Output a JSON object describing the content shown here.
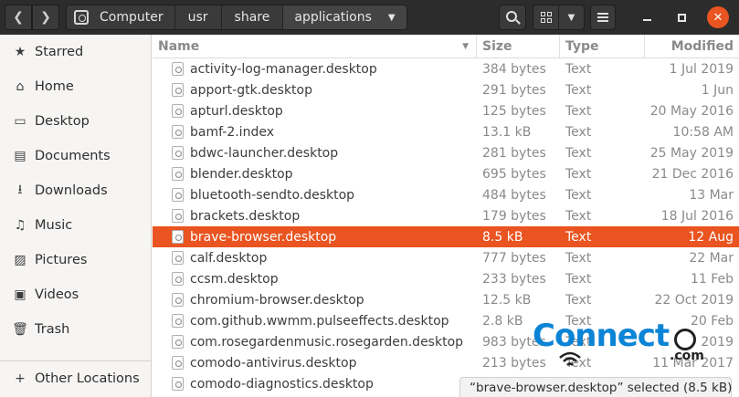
{
  "header": {
    "breadcrumbs": [
      "Computer",
      "usr",
      "share",
      "applications"
    ],
    "icons": {
      "back": "chevron-left-icon",
      "forward": "chevron-right-icon",
      "root": "drive-icon",
      "path_dropdown": "triangle-down-icon",
      "search": "search-icon",
      "view": "grid-view-icon",
      "view_dropdown": "triangle-down-icon",
      "menu": "hamburger-icon",
      "minimize": "minimize-icon",
      "maximize": "maximize-icon",
      "close": "close-icon"
    },
    "glyphs": {
      "back": "❮",
      "forward": "❯",
      "dropdown": "▼",
      "close": "✕"
    }
  },
  "sidebar": {
    "items": [
      {
        "label": "Starred",
        "icon": "star-icon",
        "glyph": "★"
      },
      {
        "label": "Home",
        "icon": "home-icon",
        "glyph": "⌂"
      },
      {
        "label": "Desktop",
        "icon": "desktop-icon",
        "glyph": "▭"
      },
      {
        "label": "Documents",
        "icon": "documents-icon",
        "glyph": "▤"
      },
      {
        "label": "Downloads",
        "icon": "downloads-icon",
        "glyph": "⭳"
      },
      {
        "label": "Music",
        "icon": "music-icon",
        "glyph": "♫"
      },
      {
        "label": "Pictures",
        "icon": "pictures-icon",
        "glyph": "▨"
      },
      {
        "label": "Videos",
        "icon": "videos-icon",
        "glyph": "▣"
      },
      {
        "label": "Trash",
        "icon": "trash-icon",
        "glyph": "🗑"
      }
    ],
    "other": {
      "label": "Other Locations",
      "icon": "plus-icon",
      "glyph": "+"
    }
  },
  "columns": {
    "name": "Name",
    "size": "Size",
    "type": "Type",
    "modified": "Modified",
    "sort_glyph": "▼"
  },
  "files": [
    {
      "name": "activity-log-manager.desktop",
      "size": "384 bytes",
      "type": "Text",
      "modified": "1 Jul 2019"
    },
    {
      "name": "apport-gtk.desktop",
      "size": "291 bytes",
      "type": "Text",
      "modified": "1 Jun"
    },
    {
      "name": "apturl.desktop",
      "size": "125 bytes",
      "type": "Text",
      "modified": "20 May 2016"
    },
    {
      "name": "bamf-2.index",
      "size": "13.1 kB",
      "type": "Text",
      "modified": "10:58 AM"
    },
    {
      "name": "bdwc-launcher.desktop",
      "size": "281 bytes",
      "type": "Text",
      "modified": "25 May 2019"
    },
    {
      "name": "blender.desktop",
      "size": "695 bytes",
      "type": "Text",
      "modified": "21 Dec 2016"
    },
    {
      "name": "bluetooth-sendto.desktop",
      "size": "484 bytes",
      "type": "Text",
      "modified": "13 Mar"
    },
    {
      "name": "brackets.desktop",
      "size": "179 bytes",
      "type": "Text",
      "modified": "18 Jul 2016"
    },
    {
      "name": "brave-browser.desktop",
      "size": "8.5 kB",
      "type": "Text",
      "modified": "12 Aug"
    },
    {
      "name": "calf.desktop",
      "size": "777 bytes",
      "type": "Text",
      "modified": "22 Mar"
    },
    {
      "name": "ccsm.desktop",
      "size": "233 bytes",
      "type": "Text",
      "modified": "11 Feb"
    },
    {
      "name": "chromium-browser.desktop",
      "size": "12.5 kB",
      "type": "Text",
      "modified": "22 Oct 2019"
    },
    {
      "name": "com.github.wwmm.pulseeffects.desktop",
      "size": "2.8 kB",
      "type": "Text",
      "modified": "20 Feb"
    },
    {
      "name": "com.rosegardenmusic.rosegarden.desktop",
      "size": "983 bytes",
      "type": "Text",
      "modified": "2019"
    },
    {
      "name": "comodo-antivirus.desktop",
      "size": "213 bytes",
      "type": "Text",
      "modified": "11 Mar 2017"
    },
    {
      "name": "comodo-diagnostics.desktop",
      "size": "",
      "type": "",
      "modified": ""
    }
  ],
  "selected_index": 8,
  "status": "“brave-browser.desktop” selected  (8.5 kB)",
  "watermark": {
    "text": "Connect",
    "suffix": ".com"
  },
  "colors": {
    "accent": "#e95420",
    "header_bg": "#2c2c2c",
    "sidebar_bg": "#f6f5f4",
    "watermark_blue": "#0b84d6"
  }
}
